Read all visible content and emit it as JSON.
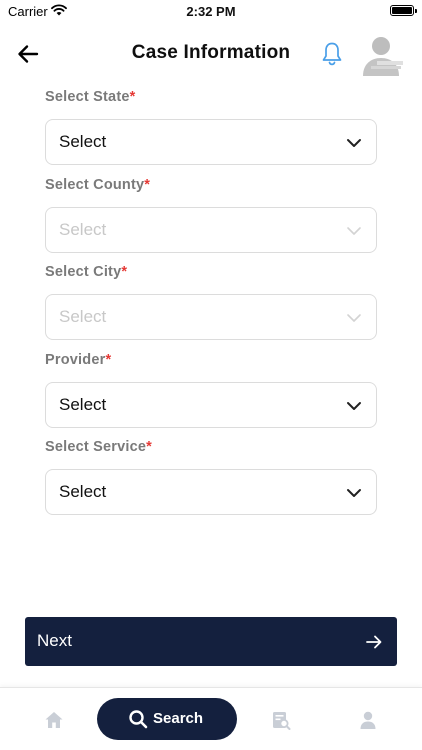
{
  "status_bar": {
    "carrier": "Carrier",
    "time": "2:32 PM"
  },
  "header": {
    "title": "Case Information",
    "back_icon": "arrow-left-icon",
    "notification_icon": "bell-icon",
    "accent_color": "#4a9fe8"
  },
  "form": {
    "required_marker": "*",
    "fields": [
      {
        "label": "Select State",
        "value": "Select",
        "enabled": true
      },
      {
        "label": "Select County",
        "value": "Select",
        "enabled": false
      },
      {
        "label": "Select City",
        "value": "Select",
        "enabled": false
      },
      {
        "label": "Provider",
        "value": "Select",
        "enabled": true
      },
      {
        "label": "Select Service",
        "value": "Select",
        "enabled": true
      }
    ]
  },
  "next_button": {
    "label": "Next",
    "icon": "arrow-right-icon",
    "color": "#14203e"
  },
  "tabbar": {
    "active": "search",
    "tabs": [
      {
        "id": "home",
        "icon": "home-icon"
      },
      {
        "id": "search",
        "icon": "search-icon",
        "label": "Search"
      },
      {
        "id": "cases",
        "icon": "case-search-icon"
      },
      {
        "id": "profile",
        "icon": "person-icon"
      }
    ],
    "inactive_color": "#c9ced6",
    "active_color": "#14203e"
  }
}
